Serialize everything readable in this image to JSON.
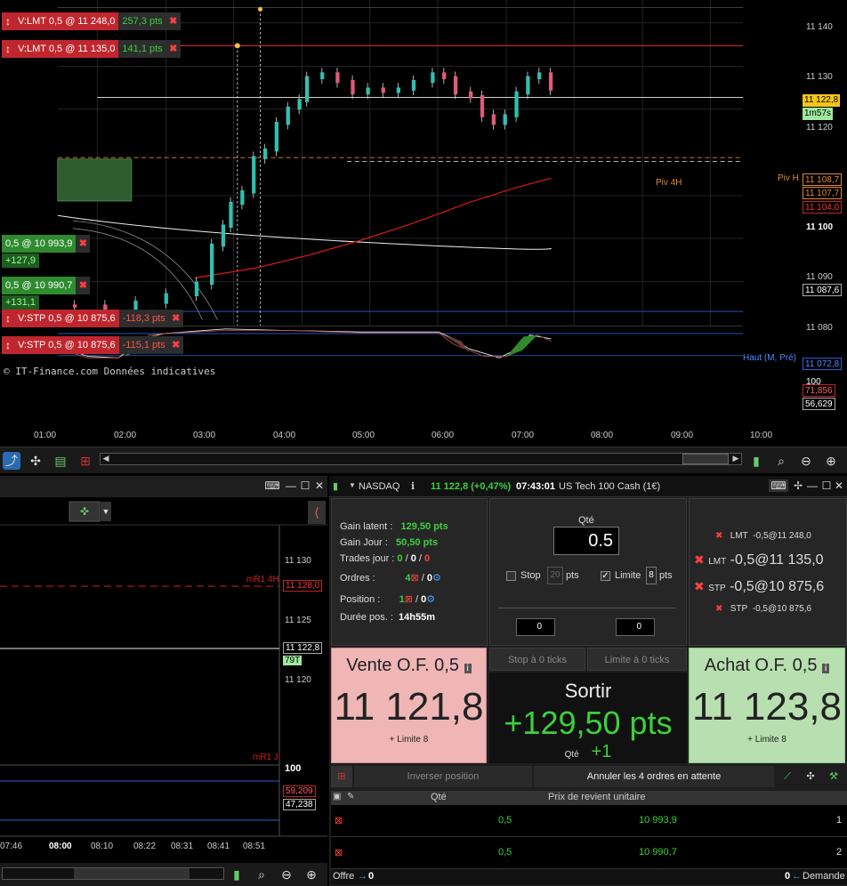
{
  "main_chart": {
    "watermark": "© IT-Finance.com  Données indicatives",
    "orders": [
      {
        "label": "V:LMT  0,5 @ 11 248,0",
        "pnl": "257,3 pts"
      },
      {
        "label": "V:LMT  0,5 @ 11 135,0",
        "pnl": "141,1 pts"
      },
      {
        "label": "V:STP  0,5 @ 10 875,6",
        "pnl": "-118,3 pts"
      },
      {
        "label": "V:STP  0,5 @ 10 875,6",
        "pnl": "-115,1 pts"
      }
    ],
    "positions": [
      {
        "label": "0,5 @ 10 993,9",
        "pnl": "+127,9"
      },
      {
        "label": "0,5 @ 10 990,7",
        "pnl": "+131,1"
      }
    ],
    "annotations": {
      "piv_4h": "Piv 4H",
      "piv_h": "Piv H",
      "haut": "Haut (M, Pré)"
    },
    "price_axis": {
      "labels": [
        "11 140",
        "11 130",
        "11 120",
        "11 100",
        "11 090",
        "11 080"
      ],
      "current_price": "11 122,8",
      "timer": "1m57s",
      "boxes": [
        "11 108,7",
        "11 107,7",
        "11 104,0",
        "11 087,6",
        "11 072,8"
      ],
      "osc_top": "100",
      "osc_boxes": [
        "71,856",
        "56,629"
      ]
    },
    "time_axis": [
      "01:00",
      "02:00",
      "03:00",
      "04:00",
      "05:00",
      "06:00",
      "07:00",
      "08:00",
      "09:00",
      "10:00"
    ]
  },
  "lower_chart": {
    "price_labels": [
      "11 130",
      "11 125",
      "11 120"
    ],
    "mr1_4h": "mR1 4H",
    "mr1_4h_value": "11 128,0",
    "current_price": "11 122,8",
    "ticks_box": "79T",
    "mr1_j": "mR1 J",
    "osc_top": "100",
    "osc_boxes": [
      "59,209",
      "47,238"
    ],
    "time_axis": [
      "07:46",
      "08:00",
      "08:10",
      "08:22",
      "08:31",
      "08:41",
      "08:51"
    ]
  },
  "trading_panel": {
    "instrument_code": "NASDAQ",
    "price_change": "11 122,8 (+0,47%)",
    "time": "07:43:01",
    "instrument_name": "US Tech 100 Cash (1€)",
    "stats": {
      "gain_latent_label": "Gain latent :",
      "gain_latent": "129,50 pts",
      "gain_jour_label": "Gain Jour :",
      "gain_jour": "50,50 pts",
      "trades_label": "Trades jour :",
      "trades_a": "0",
      "trades_b": "0",
      "trades_c": "0",
      "ordres_label": "Ordres :",
      "ordres_a": "4",
      "ordres_b": "0",
      "position_label": "Position :",
      "position_a": "1",
      "position_b": "0",
      "duree_label": "Durée pos. :",
      "duree": "14h55m"
    },
    "qty": {
      "label": "Qté",
      "value": "0.5",
      "stop_label": "Stop",
      "stop_value": "20",
      "stop_unit": "pts",
      "limit_label": "Limite",
      "limit_value": "8",
      "limit_unit": "pts",
      "spin_a": "0",
      "spin_b": "0"
    },
    "pending_orders": [
      {
        "type": "LMT",
        "text": "-0,5@11 248,0"
      },
      {
        "type": "LMT",
        "text": "-0,5@11 135,0"
      },
      {
        "type": "STP",
        "text": "-0,5@10 875,6"
      },
      {
        "type": "STP",
        "text": "-0,5@10 875,6"
      }
    ],
    "sell": {
      "title": "Vente O.F. 0,5",
      "price": "11 121,8",
      "sub": "+ Limite 8"
    },
    "buy": {
      "title": "Achat O.F. 0,5",
      "price": "11 123,8",
      "sub": "+ Limite 8"
    },
    "exit": {
      "stop_tab": "Stop à 0 ticks",
      "limit_tab": "Limite à 0 ticks",
      "title": "Sortir",
      "pnl": "+129,50 pts",
      "qty_label": "Qté",
      "qty": "+1"
    },
    "actions": {
      "reverse": "Inverser position",
      "cancel_all": "Annuler les 4 ordres en attente"
    },
    "table": {
      "headers": [
        "Qté",
        "Prix de revient unitaire"
      ],
      "rows": [
        {
          "qty": "0,5",
          "price": "10 993,9",
          "n": "1"
        },
        {
          "qty": "0,5",
          "price": "10 990,7",
          "n": "2"
        }
      ]
    },
    "footer": {
      "offer_label": "Offre",
      "offer_value": "0",
      "demand_value": "0",
      "demand_label": "Demande"
    }
  },
  "colors": {
    "sell_bg": "#f0b6b6",
    "buy_bg": "#b7dfb0",
    "green": "#3cd03c",
    "red": "#c0262d"
  }
}
